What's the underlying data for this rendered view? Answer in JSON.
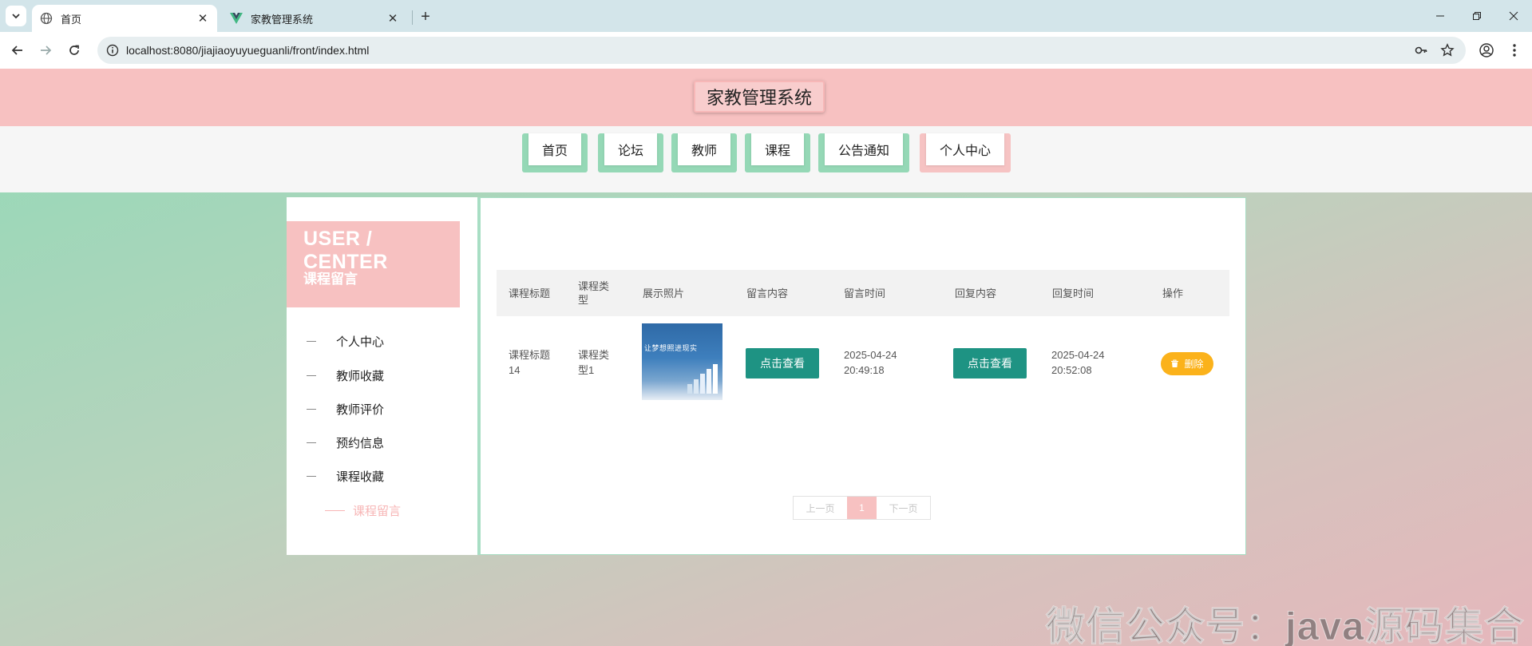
{
  "browser": {
    "tabs": [
      {
        "label": "首页",
        "active": true
      },
      {
        "label": "家教管理系统",
        "active": false
      }
    ],
    "url": "localhost:8080/jiajiaoyuyueguanli/front/index.html"
  },
  "site": {
    "title": "家教管理系统"
  },
  "nav": {
    "items": [
      "首页",
      "论坛",
      "教师",
      "课程",
      "公告通知",
      "个人中心"
    ],
    "active_index": 5
  },
  "sidebar": {
    "title": "USER / CENTER",
    "subtitle": "课程留言",
    "items": [
      "个人中心",
      "教师收藏",
      "教师评价",
      "预约信息",
      "课程收藏",
      "课程留言"
    ],
    "active_index": 5
  },
  "table": {
    "headers": [
      "课程标题",
      "课程类型",
      "展示照片",
      "留言内容",
      "留言时间",
      "回复内容",
      "回复时间",
      "操作"
    ],
    "rows": [
      {
        "title": "课程标题14",
        "type": "课程类型1",
        "photo_text": "让梦想照进现实",
        "message_button": "点击查看",
        "message_time": "2025-04-24 20:49:18",
        "reply_button": "点击查看",
        "reply_time": "2025-04-24 20:52:08",
        "delete_label": "删除"
      }
    ]
  },
  "pagination": {
    "prev": "上一页",
    "current": "1",
    "next": "下一页"
  },
  "watermark": "微信公众号：java源码集合",
  "colors": {
    "topbar": "#f7c1c1",
    "nav_accent": "#95d8b6",
    "teal_button": "#1e9383",
    "delete_button": "#fbb21b"
  }
}
